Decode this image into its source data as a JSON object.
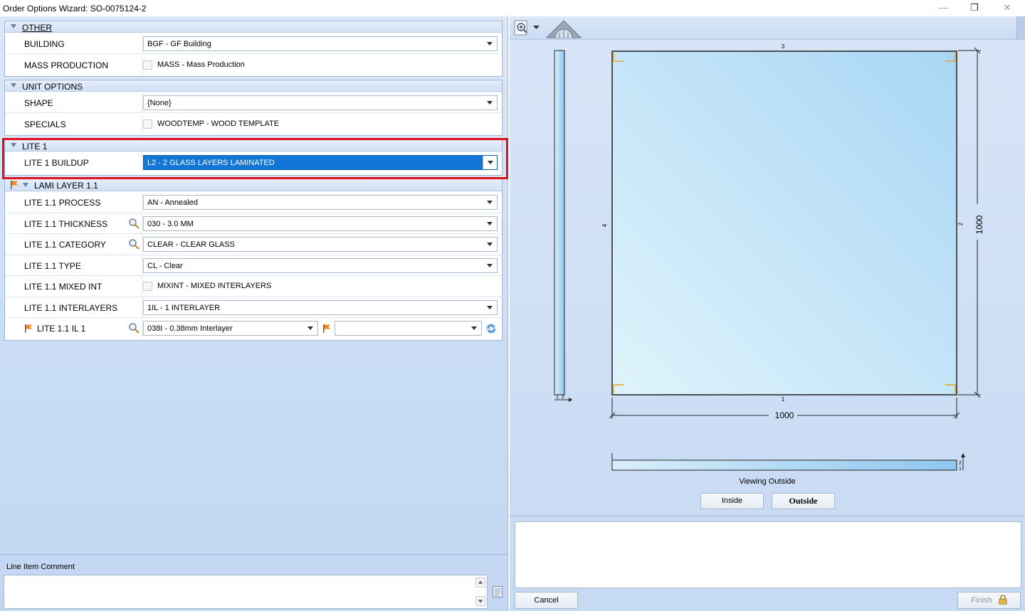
{
  "window": {
    "title": "Order Options Wizard: SO-0075124-2",
    "minimize_glyph": "—",
    "restore_glyph": "❐",
    "close_glyph": "✕"
  },
  "sections": {
    "other": {
      "header": "OTHER",
      "building_label": "BUILDING",
      "building_value": "BGF - GF Building",
      "mass_label": "MASS PRODUCTION",
      "mass_value": "MASS - Mass Production"
    },
    "unit_options": {
      "header": "UNIT OPTIONS",
      "shape_label": "SHAPE",
      "shape_value": "{None}",
      "specials_label": "SPECIALS",
      "specials_value": "WOODTEMP - WOOD TEMPLATE"
    },
    "lite1": {
      "header": "LITE 1",
      "buildup_label": "LITE 1 BUILDUP",
      "buildup_value": "L2 - 2 GLASS LAYERS LAMINATED"
    },
    "lami": {
      "header": "LAMI LAYER 1.1",
      "process_label": "LITE 1.1 PROCESS",
      "process_value": "AN - Annealed",
      "thickness_label": "LITE 1.1 THICKNESS",
      "thickness_value": "030 - 3.0 MM",
      "category_label": "LITE 1.1 CATEGORY",
      "category_value": "CLEAR - CLEAR GLASS",
      "type_label": "LITE 1.1 TYPE",
      "type_value": "CL - Clear",
      "mixed_label": "LITE 1.1 MIXED INT",
      "mixed_value": "MIXINT - MIXED INTERLAYERS",
      "interlayers_label": "LITE 1.1 INTERLAYERS",
      "interlayers_value": "1IL - 1 INTERLAYER",
      "il1_label": "LITE 1.1 IL 1",
      "il1_value": "038I - 0.38mm Interlayer",
      "il1_second_value": ""
    }
  },
  "comment": {
    "label": "Line Item Comment",
    "value": ""
  },
  "preview": {
    "top_edge": "3",
    "bottom_edge": "1",
    "left_edge": "4",
    "right_edge": "2",
    "width_dim": "1000",
    "height_dim": "1000",
    "side_bottom_a": "1",
    "side_bottom_b": "2",
    "strip_top": "2",
    "strip_bottom": "1",
    "viewing_text": "Viewing Outside",
    "inside_button": "Inside",
    "outside_button": "Outside"
  },
  "buttons": {
    "cancel": "Cancel",
    "finish": "Finish"
  },
  "colors": {
    "selected": "#1276d6",
    "highlight": "#e0101a",
    "glass_corner": "#e8a317"
  }
}
